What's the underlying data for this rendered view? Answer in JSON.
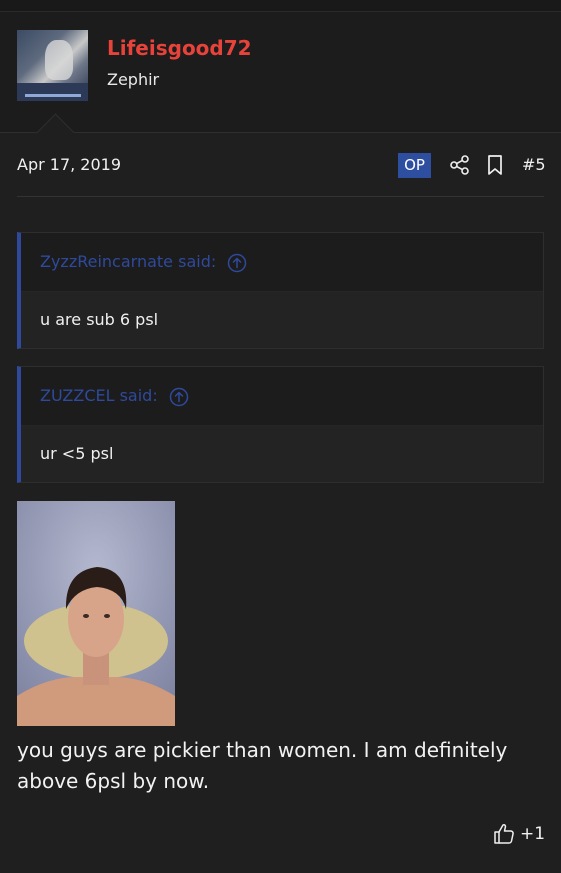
{
  "post": {
    "author": "Lifeisgood72",
    "author_title": "Zephir",
    "date": "Apr 17, 2019",
    "op_badge": "OP",
    "post_number": "#5",
    "quotes": [
      {
        "attribution": "ZyzzReincarnate said:",
        "text": "u are sub 6 psl"
      },
      {
        "attribution": "ZUZZCEL said:",
        "text": "ur <5 psl"
      }
    ],
    "body": "you guys are pickier than women. I am definitely above 6psl by now.",
    "reaction_count": "+1"
  },
  "colors": {
    "background": "#1f1f1f",
    "username": "#e8433b",
    "accent": "#2e4fa0",
    "quote_link": "#2f4a9c"
  },
  "icons": [
    "share-icon",
    "bookmark-icon",
    "arrow-up-circle-icon",
    "thumbs-up-icon"
  ]
}
